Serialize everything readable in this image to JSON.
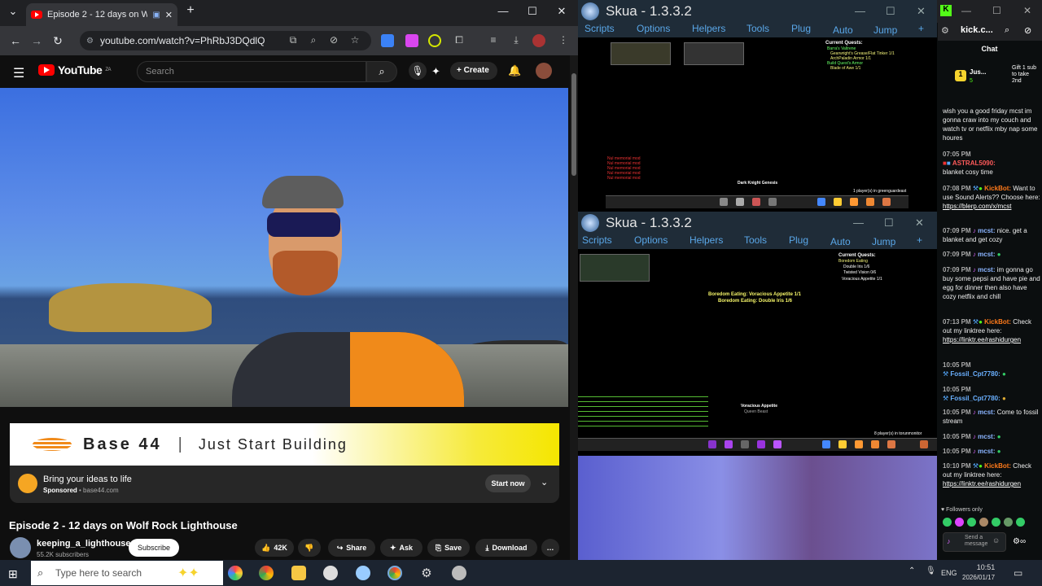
{
  "browser": {
    "tab_title": "Episode 2 - 12 days on Wo",
    "url": "youtube.com/watch?v=PhRbJ3DQdlQ"
  },
  "youtube": {
    "logo": "YouTube",
    "logo_badge": "ZA",
    "search_placeholder": "Search",
    "create_label": "Create",
    "ad": {
      "brand": "Base 44",
      "separator": "|",
      "tagline": "Just Start Building",
      "title": "Bring your ideas to life",
      "sponsored": "Sponsored",
      "domain": "• base44.com",
      "cta": "Start now"
    },
    "video_title": "Episode 2 - 12 days on Wolf Rock Lighthouse",
    "channel": "keeping_a_lighthouse",
    "subscribers": "55.2K subscribers",
    "subscribe": "Subscribe",
    "likes": "42K",
    "share": "Share",
    "ask": "Ask",
    "save": "Save",
    "download": "Download"
  },
  "skua_top": {
    "title": "Skua - 1.3.3.2",
    "menu": [
      "Scripts",
      "Options",
      "Helpers",
      "Tools",
      "Plug",
      "Auto",
      "Jump",
      "+"
    ],
    "quest_title": "Current Quests:",
    "quests": [
      "Barra's Valtrene",
      "Gearwright's Grease/Flat Tinker 1/1",
      "ArchPaladin Armor 1/1",
      "Build Quest's Armor",
      "Blade of Awe 1/1"
    ],
    "red_lines": [
      "Nul memorial mod",
      "Nul memorial mod",
      "Nul memorial mod",
      "Nul memorial mod",
      "Nul memorial mod"
    ],
    "npc": "Dark Knight Genesis",
    "players": "1 player(s) in greenguardeast"
  },
  "skua_bottom": {
    "title": "Skua - 1.3.3.2",
    "menu": [
      "Scripts",
      "Options",
      "Helpers",
      "Tools",
      "Plug",
      "Auto",
      "Jump",
      "+"
    ],
    "quest_title": "Current Quests:",
    "quests": [
      "Boredom Eating",
      "Double Iris 1/6",
      "Twisted Vision 0/6",
      "Voracious Appetite 1/1"
    ],
    "center_lines": [
      "Boredom Eating: Voracious Appetite 1/1",
      "Boredom Eating: Double Iris 1/6"
    ],
    "npc": "Voracious Appetite",
    "npc_sub": "Queen Beast",
    "players": "8 player(s) in torunmonitor"
  },
  "kick": {
    "url": "kick.c...",
    "chat_header": "Chat",
    "gift_user": "Jus...",
    "gift_count": "5",
    "gift_text": "Gift 1 sub to take 2nd",
    "messages": [
      {
        "text": "wish you a good friday mcst im gonna craw into my couch and watch tv or netflix mby nap some houres"
      },
      {
        "time": "07:05 PM",
        "user": "ASTRAL5090:",
        "text": "blanket cosy time"
      },
      {
        "time": "07:08 PM",
        "user": "KickBot:",
        "text": "Want to use Sound Alerts?? Choose here:",
        "link": "https://blerp.com/x/mcst"
      },
      {
        "time": "07:09 PM",
        "user": "mcst:",
        "text": "nice. get a blanket and get cozy"
      },
      {
        "time": "07:09 PM",
        "user": "mcst:",
        "text": ""
      },
      {
        "time": "07:09 PM",
        "user": "mcst:",
        "text": "im gonna go buy some pepsi and have pie and egg for dinner then also have cozy netflix and chill"
      },
      {
        "time": "07:13 PM",
        "user": "KickBot:",
        "text": "Check out my linktree here:",
        "link": "https://linktr.ee/rashidurgen"
      },
      {
        "time": "10:05 PM",
        "user": "Fossil_Cpt7780:",
        "text": ""
      },
      {
        "time": "10:05 PM",
        "user": "Fossil_Cpt7780:",
        "text": ""
      },
      {
        "time": "10:05 PM",
        "user": "mcst:",
        "text": "Come to fossil stream"
      },
      {
        "time": "10:05 PM",
        "user": "mcst:",
        "text": ""
      },
      {
        "time": "10:05 PM",
        "user": "mcst:",
        "text": ""
      },
      {
        "time": "10:10 PM",
        "user": "KickBot:",
        "text": "Check out my linktree here:",
        "link": "https://linktr.ee/rashidurgen"
      }
    ],
    "followers_only": "Followers only",
    "send_placeholder": "Send a message"
  },
  "taskbar": {
    "search_placeholder": "Type here to search",
    "lang": "ENG",
    "time": "10:51",
    "date": "2026/01/17"
  },
  "colors": {
    "yt_red": "#ff0000",
    "kick_green": "#53fc18",
    "skua_blue": "#5aa7e8"
  }
}
